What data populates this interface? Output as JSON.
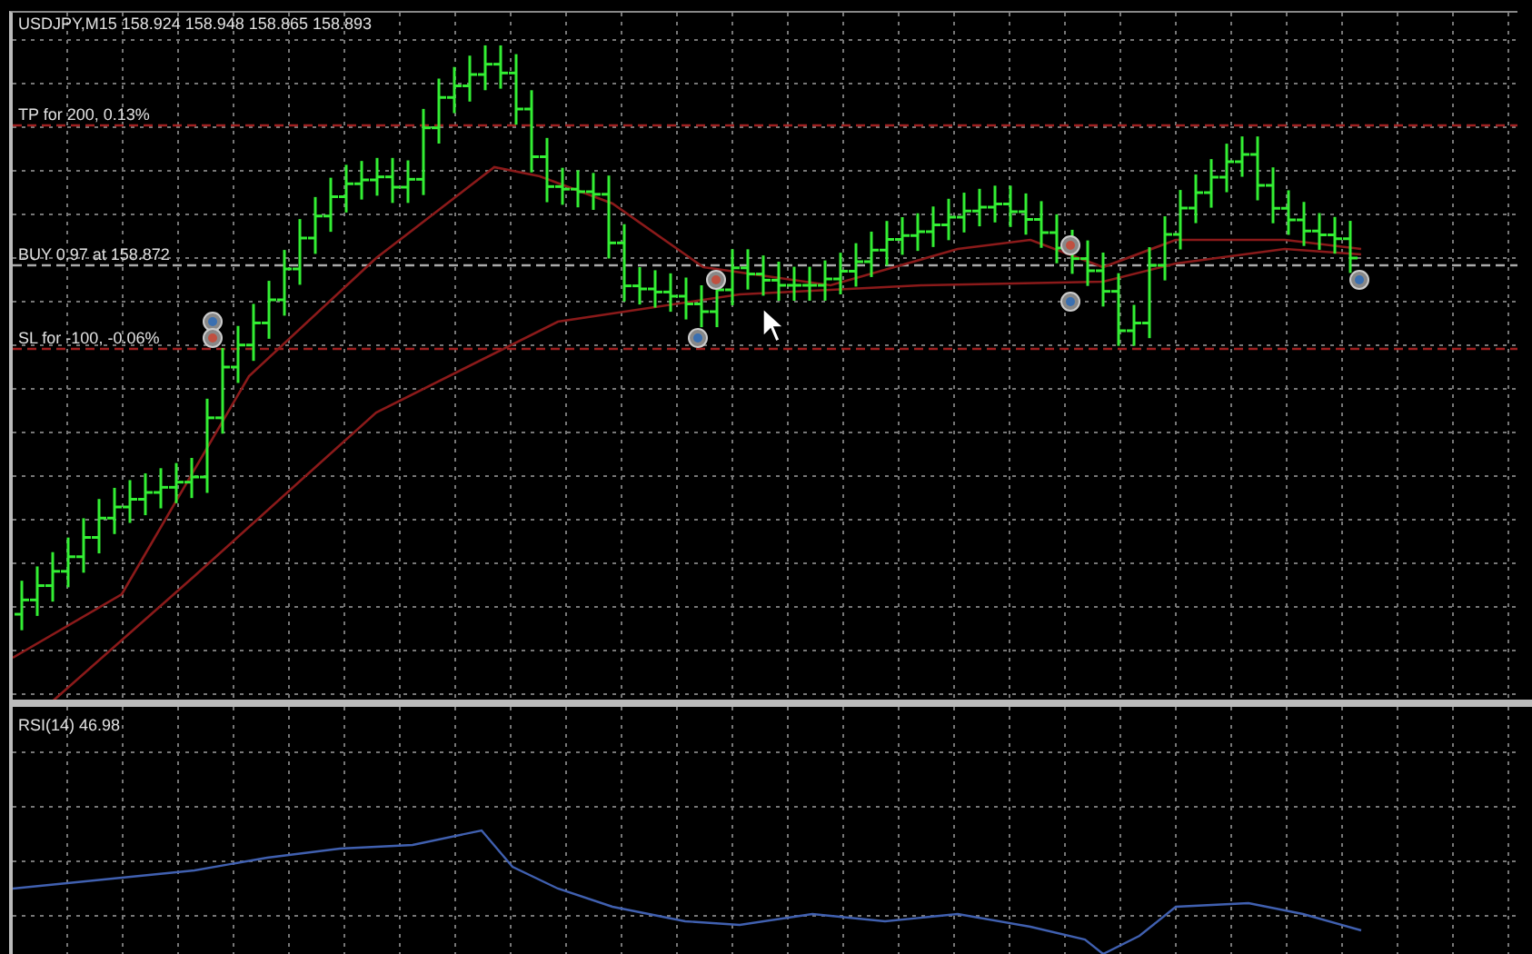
{
  "chart": {
    "header": "USDJPY,M15  158.924 158.948 158.865 158.893",
    "levels": [
      {
        "kind": "tp",
        "label": "TP for 200, 0.13%"
      },
      {
        "kind": "entry",
        "label": "BUY 0.97 at 158.872"
      },
      {
        "kind": "sl",
        "label": "SL for -100, -0.06%"
      }
    ]
  },
  "indicator": {
    "label": "RSI(14) 46.98"
  }
}
